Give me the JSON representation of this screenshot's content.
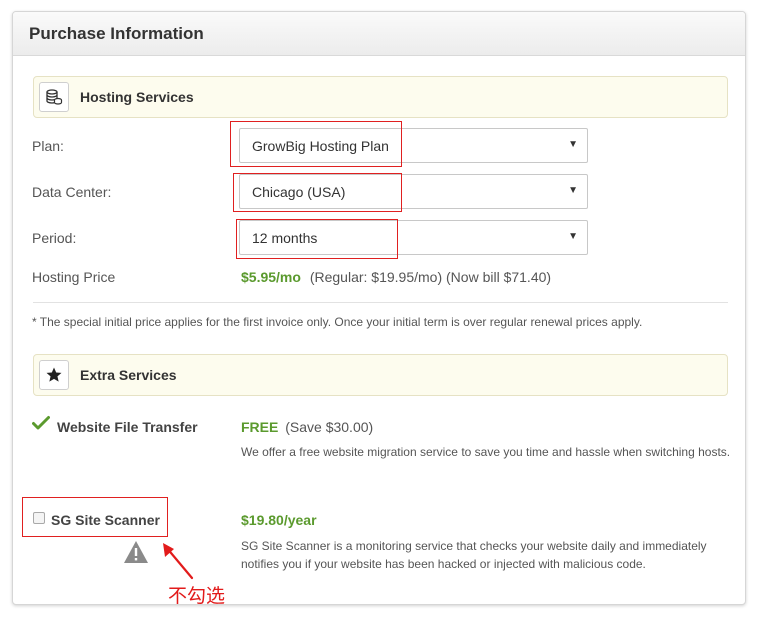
{
  "panel": {
    "title": "Purchase Information"
  },
  "hosting": {
    "section_title": "Hosting Services",
    "section_icon": "database-coins-icon",
    "plan_label": "Plan:",
    "plan_value": "GrowBig Hosting Plan",
    "datacenter_label": "Data Center:",
    "datacenter_value": "Chicago (USA)",
    "period_label": "Period:",
    "period_value": "12 months",
    "price_label": "Hosting Price",
    "price_value": "$5.95/mo",
    "price_details": "(Regular: $19.95/mo) (Now bill $71.40)",
    "note": "* The special initial price applies for the first invoice only. Once your initial term is over regular renewal prices apply."
  },
  "extras": {
    "section_title": "Extra Services",
    "section_icon": "star-icon",
    "items": [
      {
        "name": "Website File Transfer",
        "icon": "checkmark-icon",
        "price": "FREE",
        "price_note": "(Save $30.00)",
        "description": "We offer a free website migration service to save you time and hassle when switching hosts."
      },
      {
        "name": "SG Site Scanner",
        "icon": "checkbox",
        "checked": false,
        "price": "$19.80/year",
        "price_note": "",
        "description": "SG Site Scanner is a monitoring service that checks your website daily and immediately notifies you if your website has been hacked or injected with malicious code."
      }
    ]
  },
  "annotation": {
    "text": "不勾选",
    "icon": "warning-triangle-icon",
    "color": "#e21b1b"
  },
  "colors": {
    "accent_green": "#5b9a2e",
    "highlight_red": "#e02020",
    "section_bg": "#fdfcee"
  }
}
